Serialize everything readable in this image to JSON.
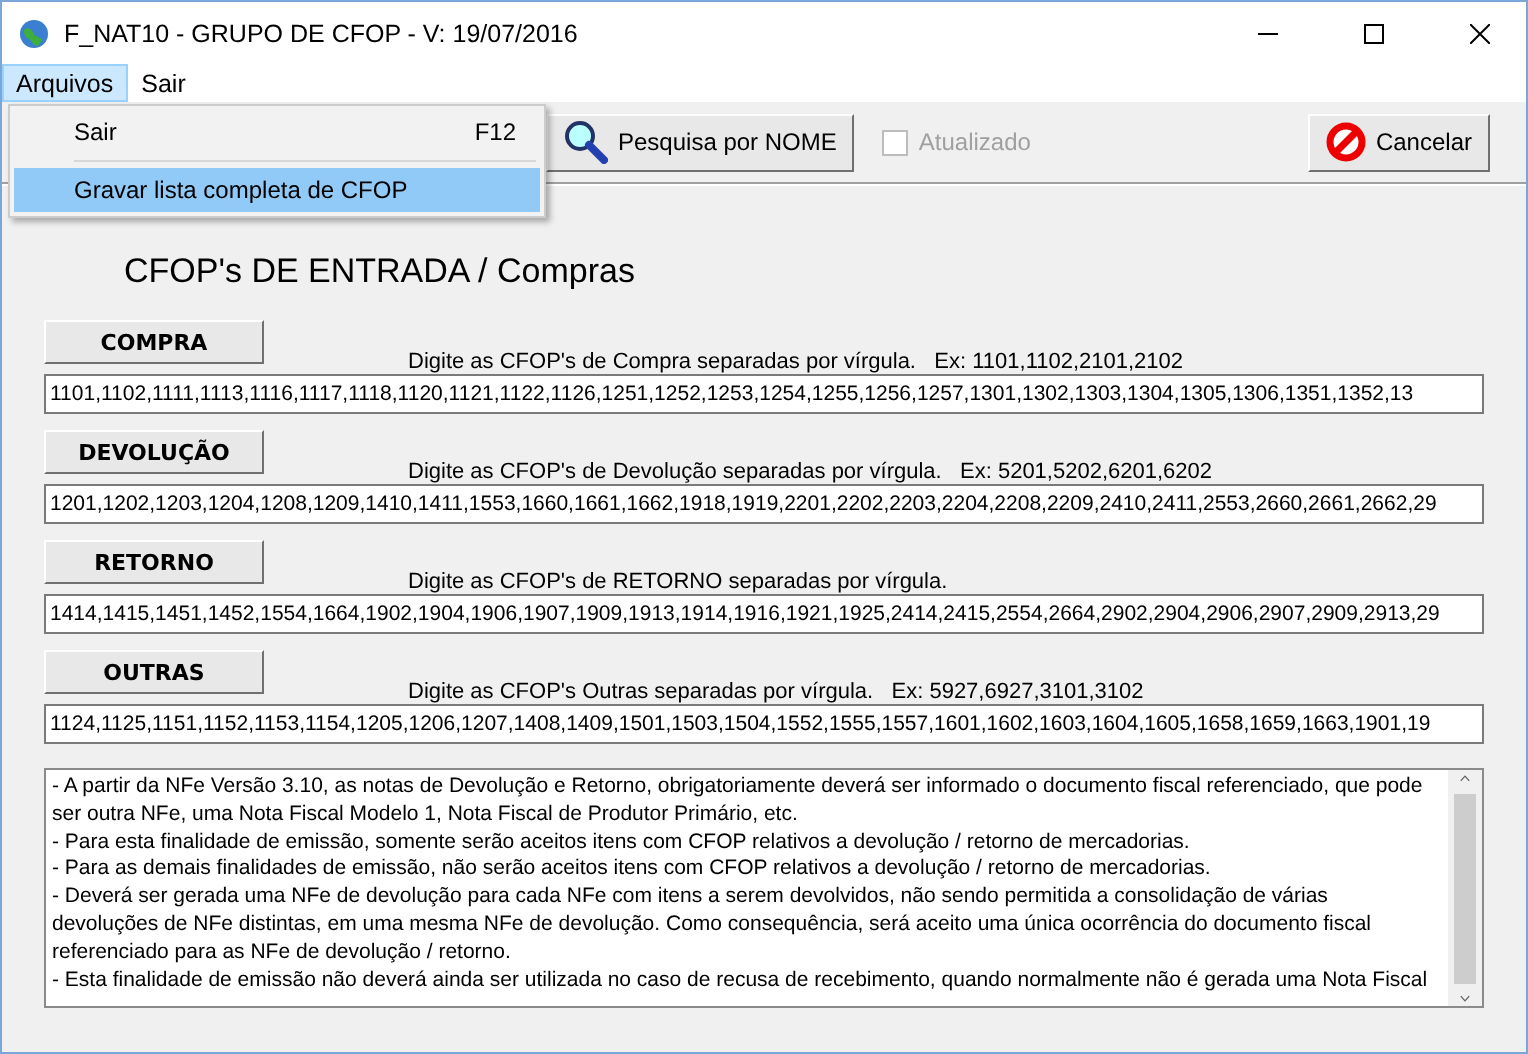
{
  "window": {
    "title": "F_NAT10 - GRUPO DE CFOP - V: 19/07/2016"
  },
  "menu_bar": [
    {
      "label": "Arquivos",
      "selected": true
    },
    {
      "label": "Sair",
      "selected": false
    }
  ],
  "menu": {
    "items": [
      {
        "label": "Sair",
        "shortcut": "F12",
        "selected": false
      },
      {
        "label": "Gravar lista completa de CFOP",
        "selected": true
      }
    ]
  },
  "toolbar": {
    "search_button": "Pesquisa por NOME",
    "updated": {
      "label": "Atualizado",
      "checked": false,
      "disabled": true
    },
    "cancel_button": "Cancelar"
  },
  "heading": "CFOP's DE ENTRADA / Compras",
  "sections": [
    {
      "button": "COMPRA",
      "hint": "Digite as CFOP's de Compra separadas por vírgula.   Ex: 1101,1102,2101,2102",
      "value": "1101,1102,1111,1113,1116,1117,1118,1120,1121,1122,1126,1251,1252,1253,1254,1255,1256,1257,1301,1302,1303,1304,1305,1306,1351,1352,13"
    },
    {
      "button": "DEVOLUÇÃO",
      "hint": "Digite as CFOP's de Devolução separadas por vírgula.   Ex: 5201,5202,6201,6202",
      "value": "1201,1202,1203,1204,1208,1209,1410,1411,1553,1660,1661,1662,1918,1919,2201,2202,2203,2204,2208,2209,2410,2411,2553,2660,2661,2662,29"
    },
    {
      "button": "RETORNO",
      "hint": "Digite as CFOP's de RETORNO separadas por vírgula.",
      "value": "1414,1415,1451,1452,1554,1664,1902,1904,1906,1907,1909,1913,1914,1916,1921,1925,2414,2415,2554,2664,2902,2904,2906,2907,2909,2913,29"
    },
    {
      "button": "OUTRAS",
      "hint": "Digite as CFOP's Outras separadas por vírgula.   Ex: 5927,6927,3101,3102",
      "value": "1124,1125,1151,1152,1153,1154,1205,1206,1207,1408,1409,1501,1503,1504,1552,1555,1557,1601,1602,1603,1604,1605,1658,1659,1663,1901,19"
    }
  ],
  "notes": [
    "- A partir da NFe Versão 3.10, as notas de Devolução e Retorno, obrigatoriamente deverá ser informado o documento fiscal referenciado, que pode",
    "ser outra NFe, uma Nota Fiscal Modelo 1, Nota Fiscal de Produtor Primário, etc.",
    "- Para esta finalidade de emissão, somente serão aceitos itens com CFOP relativos a devolução / retorno de mercadorias.",
    "- Para as demais finalidades de emissão, não serão aceitos itens com CFOP relativos a devolução / retorno de mercadorias.",
    "- Deverá ser gerada uma NFe de devolução para cada NFe com itens a serem devolvidos, não sendo permitida a consolidação de várias",
    "devoluções de NFe distintas, em uma mesma NFe de devolução. Como consequência, será aceito uma única ocorrência do documento fiscal",
    "referenciado para as NFe de devolução / retorno.",
    "- Esta finalidade de emissão não deverá ainda ser utilizada no caso de recusa de recebimento, quando normalmente não é gerada uma Nota Fiscal"
  ]
}
